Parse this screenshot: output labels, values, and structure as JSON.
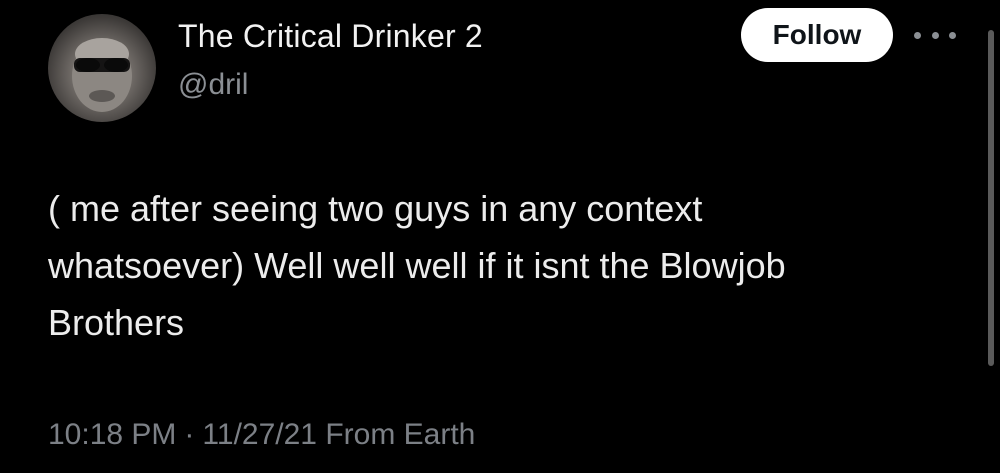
{
  "tweet": {
    "author": {
      "display_name": "The Critical Drinker 2",
      "handle": "@dril"
    },
    "follow_label": "Follow",
    "more_icon": "more-horizontal-icon",
    "text": "( me after seeing two guys in any context\nwhatsoever) Well well well if it isnt the Blowjob\nBrothers",
    "time": "10:18 PM",
    "separator": "·",
    "date": "11/27/21",
    "source": "From Earth"
  },
  "colors": {
    "background": "#000000",
    "text_primary": "#ececec",
    "text_secondary": "#7c8086",
    "button_bg": "#ffffff",
    "button_text": "#0f1419"
  }
}
